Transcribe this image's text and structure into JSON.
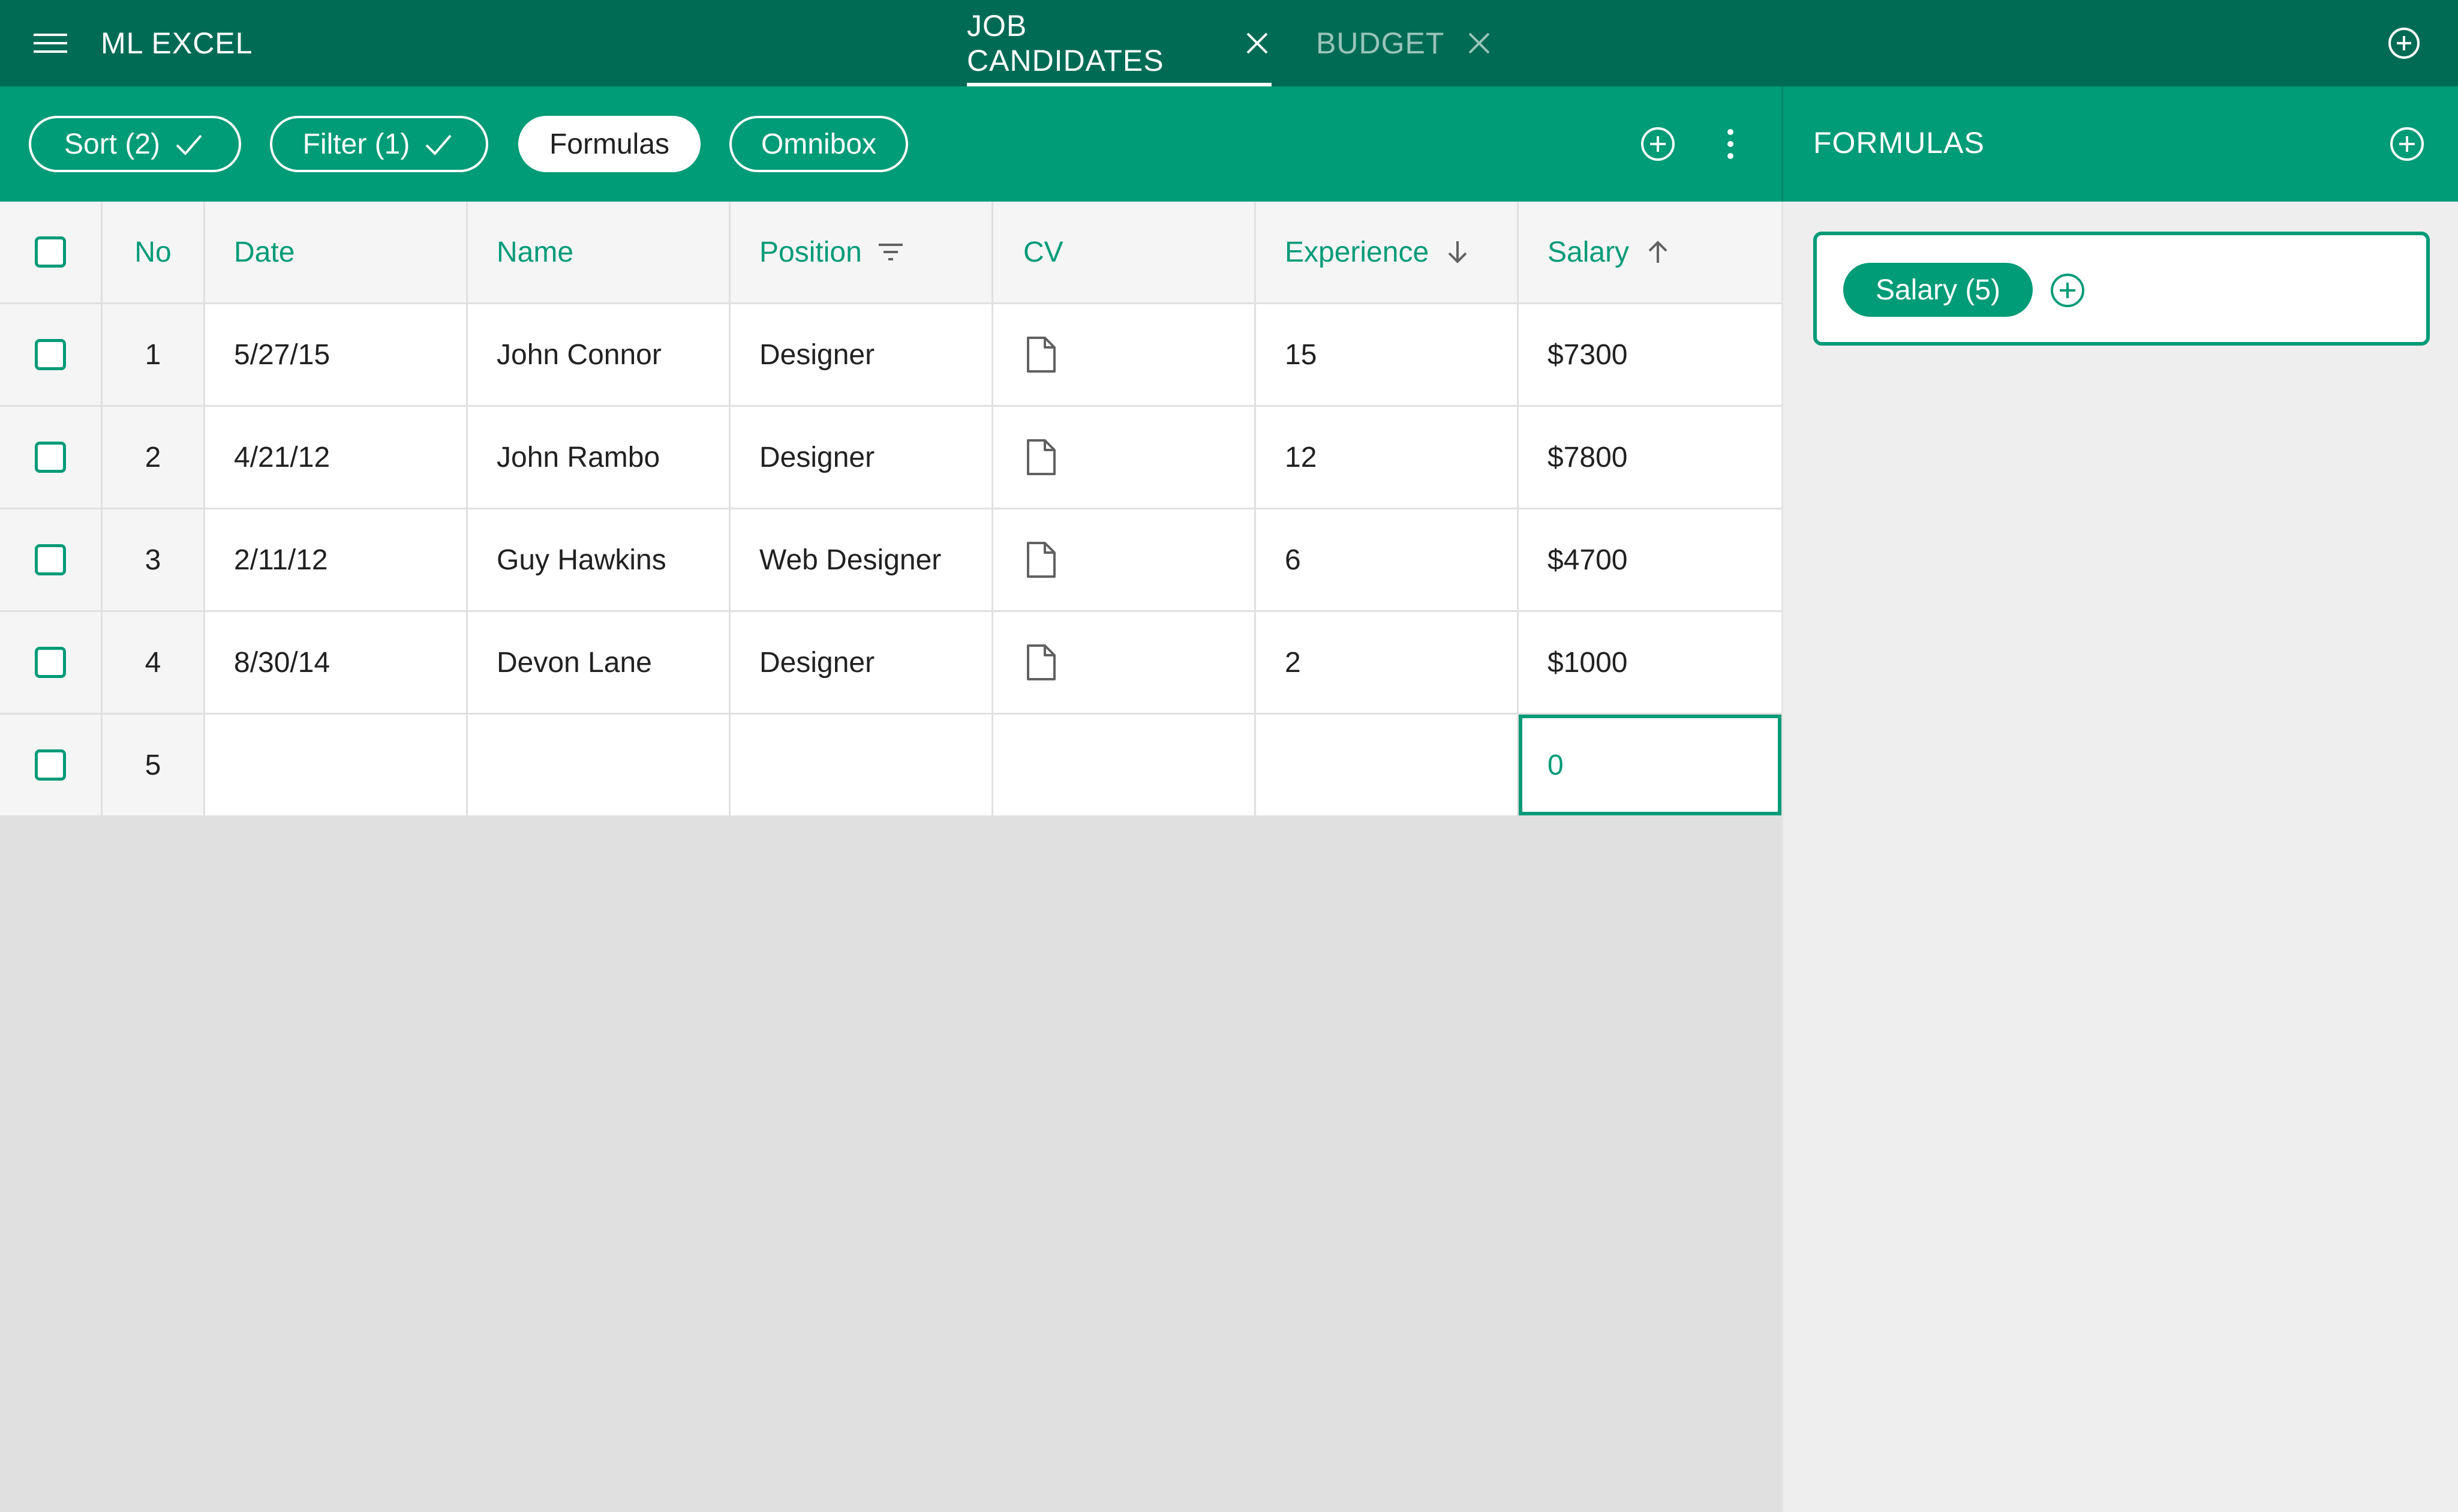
{
  "app": {
    "title": "ML EXCEL"
  },
  "tabs": [
    {
      "label": "JOB CANDIDATES",
      "active": true
    },
    {
      "label": "BUDGET",
      "active": false
    }
  ],
  "toolbar": {
    "chips": {
      "sort": "Sort (2)",
      "filter": "Filter (1)",
      "formulas": "Formulas",
      "omnibox": "Omnibox"
    }
  },
  "panel": {
    "title": "FORMULAS",
    "formula_chip": "Salary (5)"
  },
  "table": {
    "columns": {
      "no": "No",
      "date": "Date",
      "name": "Name",
      "position": "Position",
      "cv": "CV",
      "experience": "Experience",
      "salary": "Salary"
    },
    "rows": [
      {
        "no": "1",
        "date": "5/27/15",
        "name": "John Connor",
        "position": "Designer",
        "experience": "15",
        "salary": "$7300"
      },
      {
        "no": "2",
        "date": "4/21/12",
        "name": "John Rambo",
        "position": "Designer",
        "experience": "12",
        "salary": "$7800"
      },
      {
        "no": "3",
        "date": "2/11/12",
        "name": "Guy Hawkins",
        "position": "Web Designer",
        "experience": "6",
        "salary": "$4700"
      },
      {
        "no": "4",
        "date": "8/30/14",
        "name": "Devon Lane",
        "position": "Designer",
        "experience": "2",
        "salary": "$1000"
      },
      {
        "no": "5",
        "date": "",
        "name": "",
        "position": "",
        "experience": "",
        "salary": "0"
      }
    ]
  },
  "colors": {
    "appbar": "#006b55",
    "accent": "#009b77",
    "background": "#e0e0e0"
  },
  "icons": {
    "menu": "hamburger-icon",
    "tab_close": "close-icon",
    "add": "plus-circle-icon",
    "more": "more-vertical-icon",
    "check": "check-icon",
    "filter": "filter-icon",
    "sort_desc": "arrow-down-icon",
    "sort_asc": "arrow-up-icon",
    "cv": "document-icon"
  }
}
